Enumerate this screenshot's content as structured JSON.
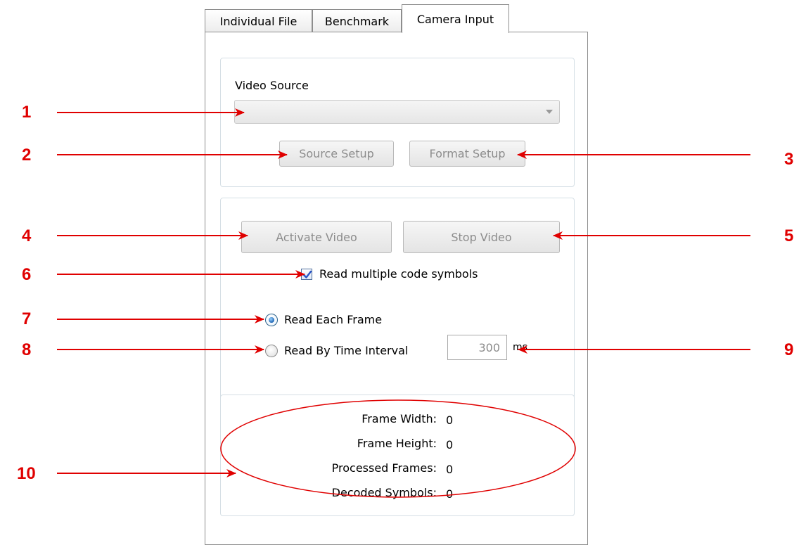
{
  "tabs": [
    {
      "label": "Individual File",
      "active": false
    },
    {
      "label": "Benchmark",
      "active": false
    },
    {
      "label": "Camera Input",
      "active": true
    }
  ],
  "video_source": {
    "label": "Video Source",
    "selected_value": "",
    "source_setup_label": "Source Setup",
    "format_setup_label": "Format Setup"
  },
  "video_controls": {
    "activate_label": "Activate Video",
    "stop_label": "Stop Video",
    "read_multiple_label": "Read multiple code symbols",
    "read_multiple_checked": true,
    "read_each_frame_label": "Read Each Frame",
    "read_each_frame_selected": true,
    "read_by_interval_label": "Read By Time Interval",
    "read_by_interval_selected": false,
    "interval_value": "300",
    "interval_unit": "ms"
  },
  "stats": {
    "frame_width_label": "Frame Width:",
    "frame_width_value": "0",
    "frame_height_label": "Frame Height:",
    "frame_height_value": "0",
    "processed_frames_label": "Processed Frames:",
    "processed_frames_value": "0",
    "decoded_symbols_label": "Decoded Symbols:",
    "decoded_symbols_value": "0"
  },
  "callouts": [
    "1",
    "2",
    "3",
    "4",
    "5",
    "6",
    "7",
    "8",
    "9",
    "10"
  ],
  "colors": {
    "annotation_red": "#e00000",
    "radio_blue": "#1c64b4",
    "check_blue": "#2a56c6"
  }
}
